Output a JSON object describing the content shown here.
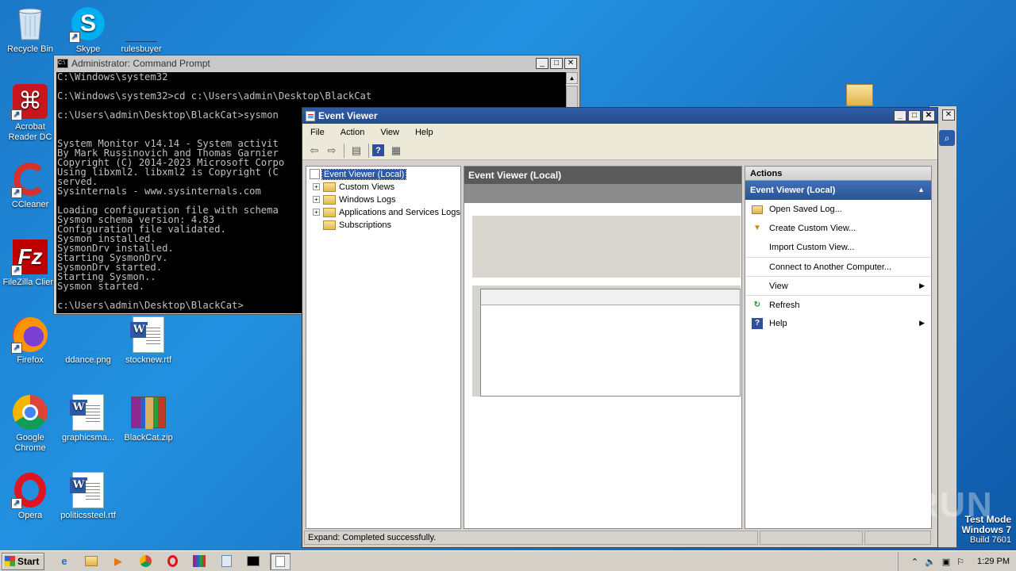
{
  "desktop": {
    "icons": [
      {
        "label": "Recycle Bin"
      },
      {
        "label": "Skype"
      },
      {
        "label": "rulesbuyer"
      },
      {
        "label": "Acrobat Reader DC"
      },
      {
        "label": "CCleaner"
      },
      {
        "label": "FileZilla Client"
      },
      {
        "label": "Firefox"
      },
      {
        "label": "ddance.png"
      },
      {
        "label": "stocknew.rtf"
      },
      {
        "label": "Google Chrome"
      },
      {
        "label": "graphicsma..."
      },
      {
        "label": "BlackCat.zip"
      },
      {
        "label": "Opera"
      },
      {
        "label": "politicssteel.rtf"
      }
    ]
  },
  "cmd": {
    "title": "Administrator: Command Prompt",
    "icon_text": "C:\\",
    "lines": [
      "C:\\Windows\\system32",
      "",
      "C:\\Windows\\system32>cd c:\\Users\\admin\\Desktop\\BlackCat",
      "",
      "c:\\Users\\admin\\Desktop\\BlackCat>sysmon",
      "",
      "",
      "System Monitor v14.14 - System activit",
      "By Mark Russinovich and Thomas Garnier",
      "Copyright (C) 2014-2023 Microsoft Corpo",
      "Using libxml2. libxml2 is Copyright (C",
      "served.",
      "Sysinternals - www.sysinternals.com",
      "",
      "Loading configuration file with schema",
      "Sysmon schema version: 4.83",
      "Configuration file validated.",
      "Sysmon installed.",
      "SysmonDrv installed.",
      "Starting SysmonDrv.",
      "SysmonDrv started.",
      "Starting Sysmon..",
      "Sysmon started.",
      "",
      "c:\\Users\\admin\\Desktop\\BlackCat>"
    ]
  },
  "eventviewer": {
    "title": "Event Viewer",
    "menu": [
      "File",
      "Action",
      "View",
      "Help"
    ],
    "tree": {
      "root": "Event Viewer (Local)",
      "items": [
        "Custom Views",
        "Windows Logs",
        "Applications and Services Logs",
        "Subscriptions"
      ]
    },
    "center_header": "Event Viewer (Local)",
    "actions": {
      "header": "Actions",
      "section": "Event Viewer (Local)",
      "items": [
        {
          "label": "Open Saved Log...",
          "icon": "folder-open-icon"
        },
        {
          "label": "Create Custom View...",
          "icon": "filter-icon"
        },
        {
          "label": "Import Custom View...",
          "icon": ""
        },
        {
          "label": "Connect to Another Computer...",
          "icon": ""
        },
        {
          "label": "View",
          "icon": ""
        },
        {
          "label": "Refresh",
          "icon": "refresh-icon"
        },
        {
          "label": "Help",
          "icon": "help-icon"
        }
      ]
    },
    "status": "Expand:  Completed successfully."
  },
  "taskbar": {
    "start_label": "Start",
    "clock": "1:29 PM"
  },
  "watermark": "ANY RUN",
  "testmode": {
    "line1": "Test Mode",
    "line2": "Windows 7",
    "line3": "Build 7601"
  }
}
